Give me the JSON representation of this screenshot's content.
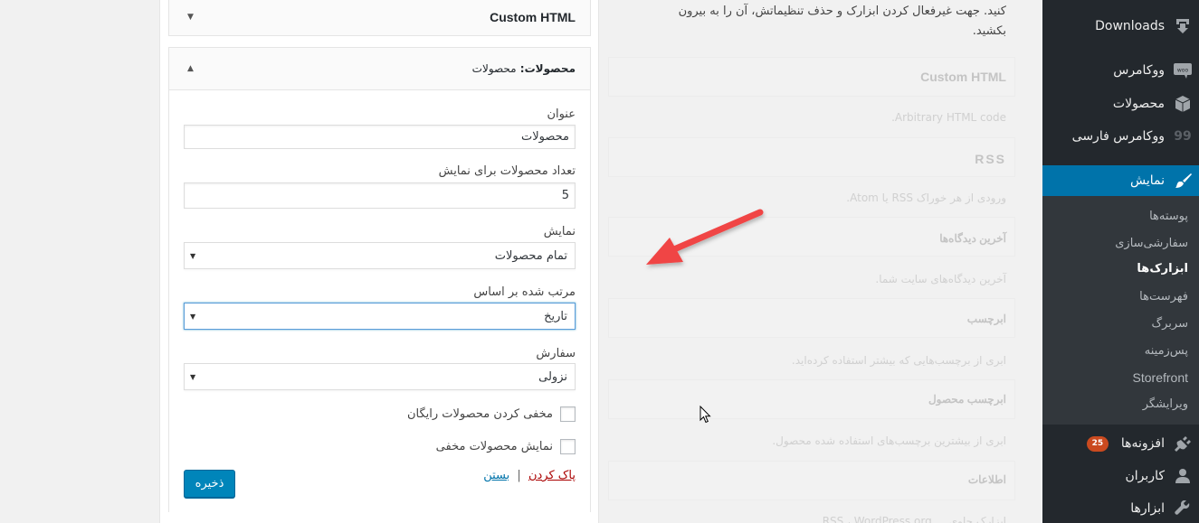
{
  "widget_area": {
    "collapsed_widget": {
      "title": "Custom HTML"
    },
    "open_widget": {
      "title_prefix": "محصولات:",
      "title_name": "محصولات",
      "fields": {
        "title_label": "عنوان",
        "title_value": "محصولات",
        "count_label": "تعداد محصولات برای نمایش",
        "count_value": "5",
        "show_label": "نمایش",
        "show_value": "تمام محصولات",
        "orderby_label": "مرتب شده بر اساس",
        "orderby_value": "تاریخ",
        "order_label": "سفارش",
        "order_value": "نزولی"
      },
      "checkboxes": [
        {
          "label": "مخفی کردن محصولات رایگان",
          "checked": false
        },
        {
          "label": "نمایش محصولات مخفی",
          "checked": false
        }
      ],
      "delete_link": "پاک کردن",
      "separator": "|",
      "close_link": "بستن",
      "save_button": "ذخیره"
    }
  },
  "available_widgets": {
    "intro": "کنید. جهت غیرفعال کردن ابزارک و حذف تنظیماتش، آن را به بیرون بکشید.",
    "items": [
      {
        "title": "Custom HTML",
        "desc": "Arbitrary HTML code."
      },
      {
        "title": "RSS",
        "desc": "ورودی از هر خوراک RSS یا Atom."
      },
      {
        "title": "آخرین دیدگاه‌ها",
        "desc": "آخرین دیدگاه‌های سایت شما."
      },
      {
        "title": "ابرچسب",
        "desc": "ابری از برچسب‌هایی که بیشتر استفاده کرده‌اید."
      },
      {
        "title": "ابرچسب محصول",
        "desc": "ابری از بیشترین برچسب‌های استفاده شده محصول."
      },
      {
        "title": "اطلاعات",
        "desc": "ابزارک حاوی ... RSS ، WordPress.org"
      }
    ]
  },
  "admin_menu": {
    "items": [
      {
        "label": "Downloads",
        "icon": "download-icon"
      },
      {
        "label": "ووکامرس",
        "icon": "woo-icon"
      },
      {
        "label": "محصولات",
        "icon": "products-box-icon"
      },
      {
        "label": "ووکامرس فارسی",
        "icon": "quote-icon"
      },
      {
        "label": "نمایش",
        "icon": "paintbrush-icon",
        "current": true
      },
      {
        "label": "افزونه‌ها",
        "icon": "plugin-icon",
        "badge": "25"
      },
      {
        "label": "کاربران",
        "icon": "user-icon"
      },
      {
        "label": "ابزارها",
        "icon": "wrench-icon"
      }
    ],
    "submenu": [
      {
        "label": "پوسته‌ها"
      },
      {
        "label": "سفارشی‌سازی"
      },
      {
        "label": "ابزارک‌ها",
        "current": true
      },
      {
        "label": "فهرست‌ها"
      },
      {
        "label": "سربرگ"
      },
      {
        "label": "پس‌زمینه"
      },
      {
        "label": "Storefront"
      },
      {
        "label": "ویرایشگر"
      }
    ]
  },
  "colors": {
    "admin_bg": "#23282d",
    "submenu_bg": "#32373c",
    "accent": "#0073aa",
    "button": "#0085ba",
    "badge": "#ca4a1f",
    "delete_link": "#a00000",
    "annotation_arrow": "#f04545"
  }
}
